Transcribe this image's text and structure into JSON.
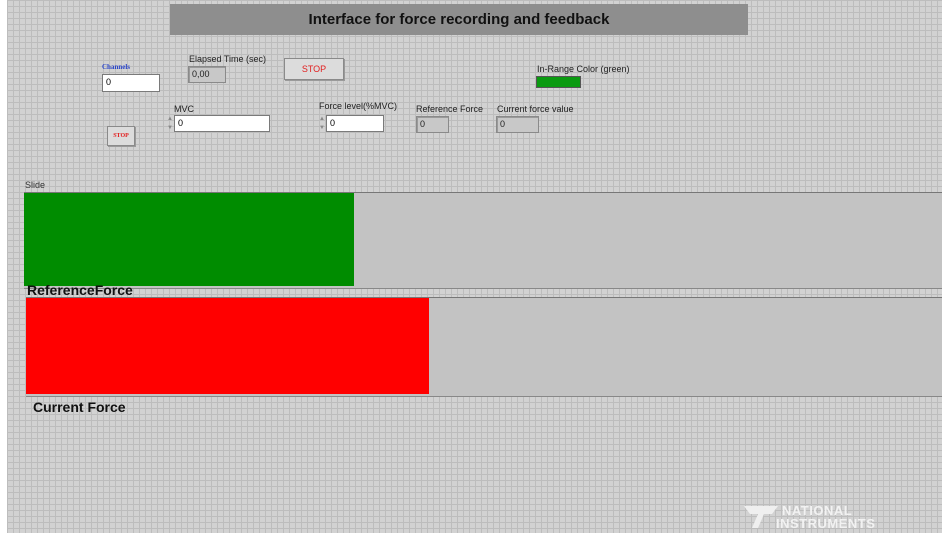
{
  "title": "Interface for force recording and feedback",
  "channels": {
    "label": "Channels",
    "value": "0"
  },
  "elapsed": {
    "label": "Elapsed Time (sec)",
    "value": "0,00"
  },
  "stop_top": {
    "label": "STOP"
  },
  "stop_small": {
    "label": "STOP"
  },
  "in_range": {
    "label": "In-Range Color (green)",
    "color": "#0a9a10"
  },
  "mvc": {
    "label": "MVC",
    "value": "0"
  },
  "force_level": {
    "label": "Force level(%MVC)",
    "value": "0"
  },
  "reference_force": {
    "label": "Reference Force",
    "value": "0"
  },
  "current_force_value": {
    "label": "Current force value",
    "value": "0"
  },
  "slide": {
    "label": "Slide"
  },
  "reference_bar": {
    "label": "ReferenceForce",
    "color": "#008c00",
    "fill_fraction": 0.36
  },
  "current_bar": {
    "label": "Current Force",
    "color": "#ff0000",
    "fill_fraction": 0.44
  },
  "logo": {
    "line1": "NATIONAL",
    "line2": "INSTRUMENTS"
  }
}
